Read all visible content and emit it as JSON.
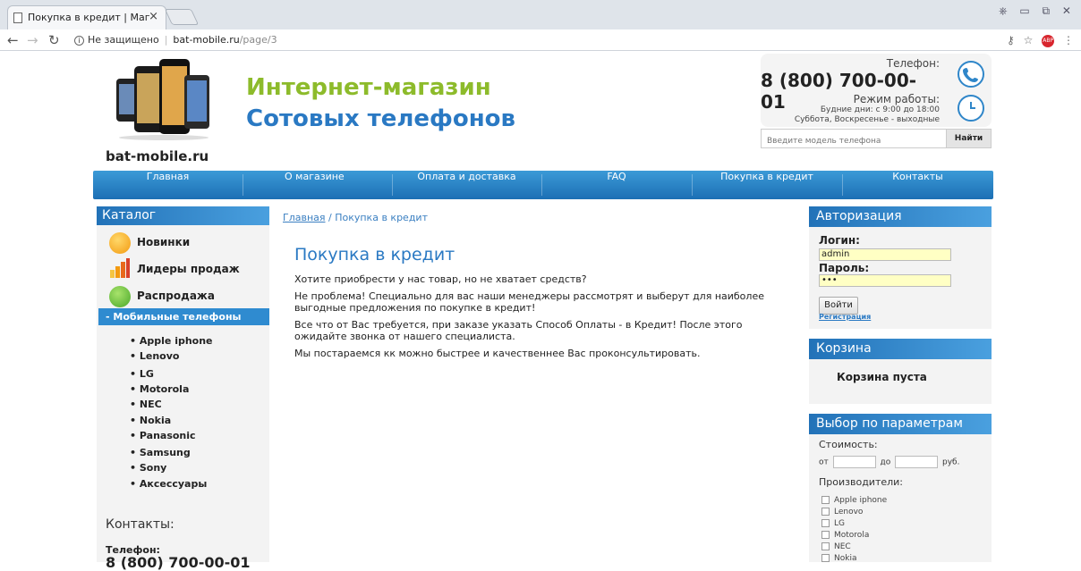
{
  "browser": {
    "tab_title": "Покупка в кредит | Маг",
    "tab_close": "×",
    "security": "Не защищено",
    "url_host": "bat-mobile.ru",
    "url_path": "/page/3",
    "window_buttons": "⎈ ▭ ⧉ ✕"
  },
  "header": {
    "logo_text": "bat-mobile.ru",
    "slogan_line1": "Интернет-магазин",
    "slogan_line2": "Сотовых телефонов",
    "phone_label": "Телефон:",
    "phone": "8 (800) 700-00-01",
    "hours_label": "Режим работы:",
    "hours_weekdays": "Будние дни: с 9:00 до 18:00",
    "hours_weekend": "Суббота, Воскресенье - выходные",
    "search_placeholder": "Введите модель телефона",
    "search_button": "Найти"
  },
  "nav": [
    "Главная",
    "О магазине",
    "Оплата и доставка",
    "FAQ",
    "Покупка в кредит",
    "Контакты"
  ],
  "catalog": {
    "heading": "Каталог",
    "items": [
      "Новинки",
      "Лидеры продаж",
      "Распродажа"
    ],
    "mobile_heading": "- Мобильные телефоны",
    "brands": [
      "Apple iphone",
      "Lenovo",
      "LG",
      "Motorola",
      "NEC",
      "Nokia",
      "Panasonic",
      "Samsung",
      "Sony",
      "Аксессуары"
    ]
  },
  "contacts": {
    "heading": "Контакты:",
    "phone_label": "Телефон:",
    "phone": "8 (800) 700-00-01"
  },
  "main": {
    "breadcrumb_home": "Главная",
    "breadcrumb_current": " / Покупка в кредит",
    "title": "Покупка в кредит",
    "paragraphs": [
      "Хотите приобрести у нас товар, но не хватает средств?",
      "Не проблема! Специально для вас наши менеджеры рассмотрят и выберут для наиболее выгодные предложения по покупке в кредит!",
      "Все что от Вас требуется, при заказе указать Способ Оплаты - в Кредит! После этого ожидайте звонка от нашего специалиста.",
      "Мы постараемся кк можно быстрее и качественнее Вас проконсультировать."
    ]
  },
  "auth": {
    "heading": "Авторизация",
    "login_label": "Логин:",
    "login_value": "admin",
    "password_label": "Пароль:",
    "password_value": "•••",
    "login_button": "Войти",
    "register_link": "Регистрация"
  },
  "cart": {
    "heading": "Корзина",
    "empty_text": "Корзина пуста"
  },
  "filter": {
    "heading": "Выбор по параметрам",
    "price_label": "Стоимость:",
    "from": "от",
    "to": "до",
    "currency": "руб.",
    "makers_label": "Производители:",
    "makers": [
      "Apple iphone",
      "Lenovo",
      "LG",
      "Motorola",
      "NEC",
      "Nokia"
    ]
  },
  "colors": {
    "nav_blue": "#2272b8",
    "accent_green": "#8dbb2b",
    "accent_blue": "#2a79c3",
    "input_yellow": "#ffffc4"
  }
}
